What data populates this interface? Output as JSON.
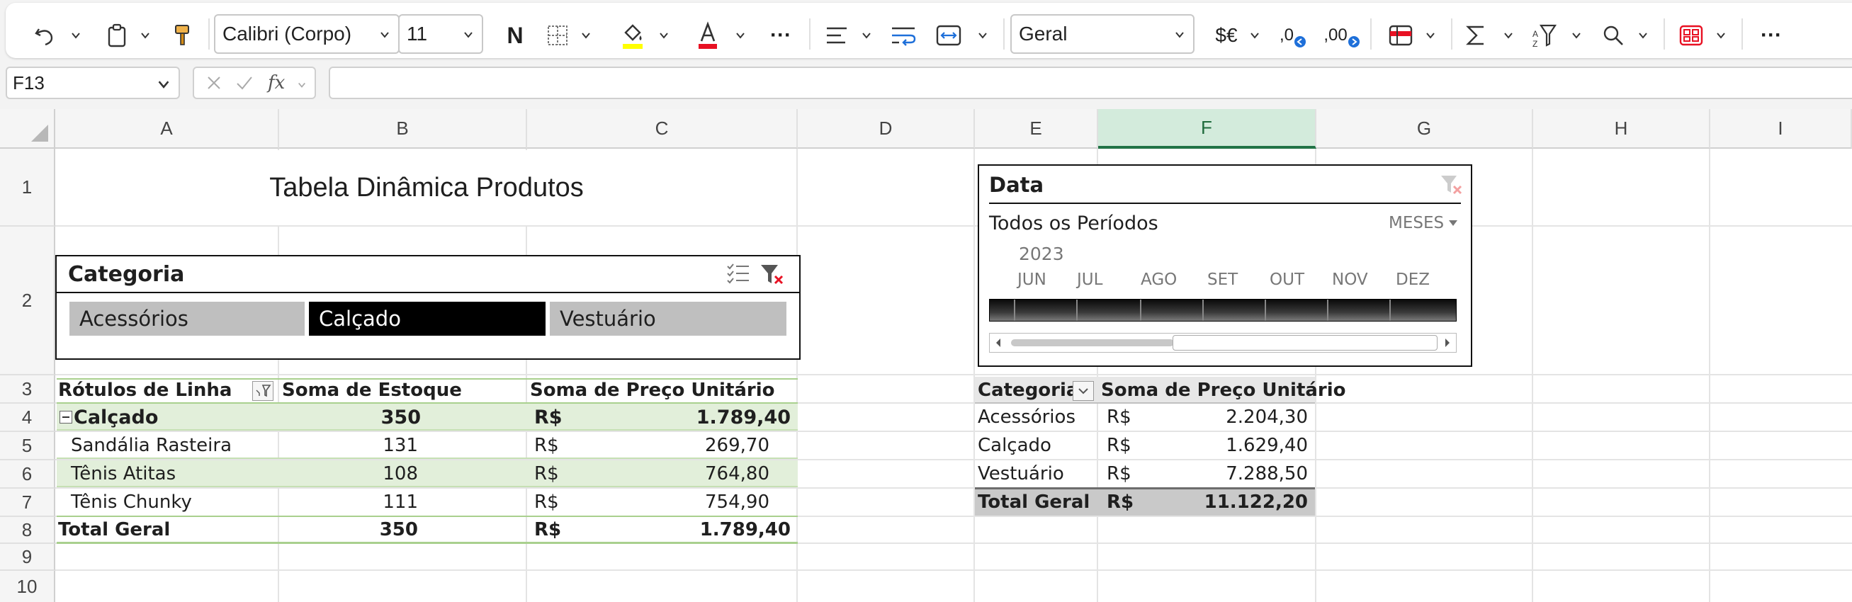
{
  "ribbon": {
    "font_name": "Calibri (Corpo)",
    "font_size": "11",
    "bold_label": "N",
    "ellipsis_label": "···",
    "number_format": "Geral",
    "currency_label": "$€",
    "dec_increase_label": ",0",
    "dec_decrease_label": ",00",
    "fill_color": "#ffff00",
    "font_color": "#e81123"
  },
  "formula_bar": {
    "cell_ref": "F13",
    "fx_label": "fx",
    "formula": ""
  },
  "columns": [
    "A",
    "B",
    "C",
    "D",
    "E",
    "F",
    "G",
    "H",
    "I"
  ],
  "selected_column": "F",
  "rows": [
    "1",
    "2",
    "3",
    "4",
    "5",
    "6",
    "7",
    "8",
    "9",
    "10"
  ],
  "sheet": {
    "title": "Tabela Dinâmica Produtos"
  },
  "category_slicer": {
    "header": "Categoria",
    "items": [
      {
        "label": "Acessórios",
        "selected": false
      },
      {
        "label": "Calçado",
        "selected": true
      },
      {
        "label": "Vestuário",
        "selected": false
      }
    ]
  },
  "timeline": {
    "header": "Data",
    "period_label": "Todos os Períodos",
    "level": "MESES",
    "year": "2023",
    "months": [
      "JUN",
      "JUL",
      "AGO",
      "SET",
      "OUT",
      "NOV",
      "DEZ"
    ]
  },
  "pivot1": {
    "headers": [
      "Rótulos de Linha",
      "Soma de Estoque",
      "Soma de Preço Unitário"
    ],
    "group": {
      "label": "Calçado",
      "stock": "350",
      "currency": "R$",
      "price": "1.789,40"
    },
    "rows": [
      {
        "label": "Sandália Rasteira",
        "stock": "131",
        "currency": "R$",
        "price": "269,70"
      },
      {
        "label": "Tênis Atitas",
        "stock": "108",
        "currency": "R$",
        "price": "764,80"
      },
      {
        "label": "Tênis Chunky",
        "stock": "111",
        "currency": "R$",
        "price": "754,90"
      }
    ],
    "total": {
      "label": "Total Geral",
      "stock": "350",
      "currency": "R$",
      "price": "1.789,40"
    }
  },
  "pivot2": {
    "headers": [
      "Categoria",
      "Soma de Preço Unitário"
    ],
    "rows": [
      {
        "label": "Acessórios",
        "currency": "R$",
        "price": "2.204,30"
      },
      {
        "label": "Calçado",
        "currency": "R$",
        "price": "1.629,40"
      },
      {
        "label": "Vestuário",
        "currency": "R$",
        "price": "7.288,50"
      }
    ],
    "total": {
      "label": "Total Geral",
      "currency": "R$",
      "price": "11.122,20"
    }
  },
  "colors": {
    "accent": "#217346",
    "pivot_band": "#e2efda",
    "pivot_line": "#a9d08e",
    "total_fill": "#c9c9c9",
    "slicer_selected": "#000000",
    "slicer_unselected": "#bfbfbf"
  }
}
